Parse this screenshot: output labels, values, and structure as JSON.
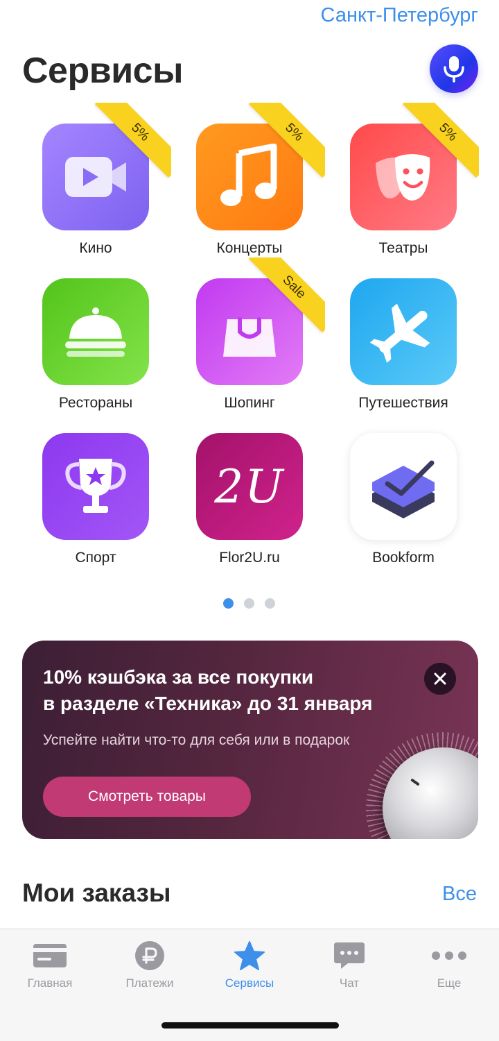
{
  "header": {
    "city": "Санкт-Петербург",
    "title": "Сервисы",
    "mic_icon": "microphone-icon"
  },
  "services": [
    {
      "label": "Кино",
      "icon": "video-camera-icon",
      "badge": "5%"
    },
    {
      "label": "Концерты",
      "icon": "music-note-icon",
      "badge": "5%"
    },
    {
      "label": "Театры",
      "icon": "theater-masks-icon",
      "badge": "5%"
    },
    {
      "label": "Рестораны",
      "icon": "cloche-icon",
      "badge": ""
    },
    {
      "label": "Шопинг",
      "icon": "shopping-bag-icon",
      "badge": "Sale"
    },
    {
      "label": "Путешествия",
      "icon": "airplane-icon",
      "badge": ""
    },
    {
      "label": "Спорт",
      "icon": "trophy-icon",
      "badge": ""
    },
    {
      "label": "Flor2U.ru",
      "icon": "flor2u-logo",
      "logo_text": "2U",
      "badge": ""
    },
    {
      "label": "Bookform",
      "icon": "bookform-logo",
      "badge": ""
    }
  ],
  "pagination": {
    "pages": 3,
    "current": 1
  },
  "promo": {
    "title_line1": "10% кэшбэка за все покупки",
    "title_line2": "в разделе «Техника» до 31 января",
    "subtitle": "Успейте найти что-то для себя или в подарок",
    "button": "Смотреть товары",
    "close_icon": "close-icon"
  },
  "orders": {
    "title": "Мои заказы",
    "all_link": "Все"
  },
  "tabbar": [
    {
      "label": "Главная",
      "icon": "card-icon",
      "active": false
    },
    {
      "label": "Платежи",
      "icon": "ruble-icon",
      "active": false
    },
    {
      "label": "Сервисы",
      "icon": "star-icon",
      "active": true
    },
    {
      "label": "Чат",
      "icon": "chat-icon",
      "active": false
    },
    {
      "label": "Еще",
      "icon": "more-dots-icon",
      "active": false
    }
  ],
  "colors": {
    "accent": "#3d8fea",
    "ribbon": "#f9d11f",
    "promo_button": "#c13a73"
  }
}
